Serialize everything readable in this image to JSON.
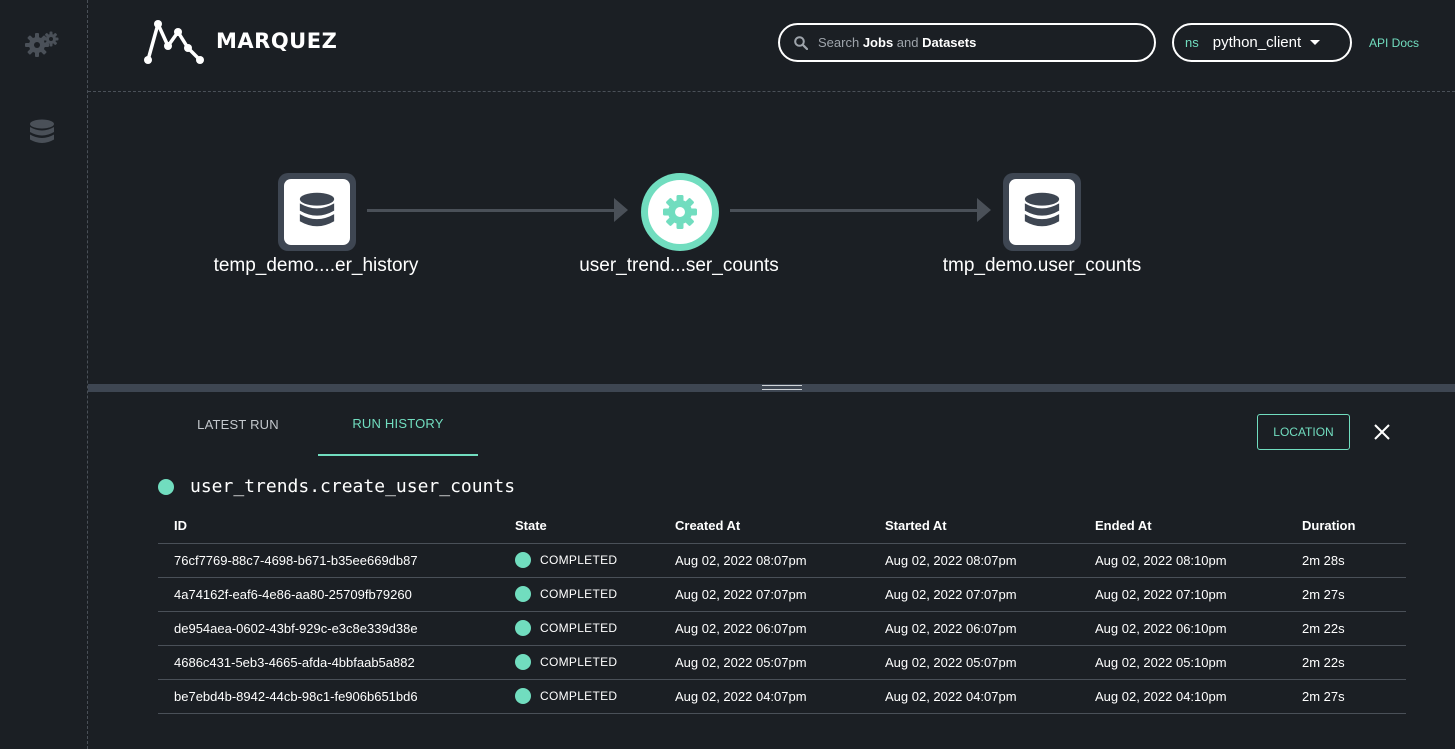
{
  "header": {
    "logo_text": "MARQUEZ",
    "search": {
      "prefix": "Search",
      "jobs": "Jobs",
      "and": "and",
      "datasets": "Datasets"
    },
    "namespace": {
      "label": "ns",
      "value": "python_client"
    },
    "api_docs": "API Docs"
  },
  "sidebar": {
    "items": [
      {
        "icon": "gears-icon"
      },
      {
        "icon": "database-icon"
      }
    ]
  },
  "graph": {
    "nodes": [
      {
        "type": "dataset",
        "label": "temp_demo....er_history"
      },
      {
        "type": "job",
        "label": "user_trend...ser_counts"
      },
      {
        "type": "dataset",
        "label": "tmp_demo.user_counts"
      }
    ]
  },
  "panel": {
    "tabs": [
      {
        "label": "LATEST RUN",
        "active": false
      },
      {
        "label": "RUN HISTORY",
        "active": true
      }
    ],
    "location_button": "LOCATION",
    "job_name": "user_trends.create_user_counts",
    "table": {
      "headers": [
        "ID",
        "State",
        "Created At",
        "Started At",
        "Ended At",
        "Duration"
      ],
      "rows": [
        {
          "id": "76cf7769-88c7-4698-b671-b35ee669db87",
          "state": "COMPLETED",
          "created": "Aug 02, 2022 08:07pm",
          "started": "Aug 02, 2022 08:07pm",
          "ended": "Aug 02, 2022 08:10pm",
          "duration": "2m 28s"
        },
        {
          "id": "4a74162f-eaf6-4e86-aa80-25709fb79260",
          "state": "COMPLETED",
          "created": "Aug 02, 2022 07:07pm",
          "started": "Aug 02, 2022 07:07pm",
          "ended": "Aug 02, 2022 07:10pm",
          "duration": "2m 27s"
        },
        {
          "id": "de954aea-0602-43bf-929c-e3c8e339d38e",
          "state": "COMPLETED",
          "created": "Aug 02, 2022 06:07pm",
          "started": "Aug 02, 2022 06:07pm",
          "ended": "Aug 02, 2022 06:10pm",
          "duration": "2m 22s"
        },
        {
          "id": "4686c431-5eb3-4665-afda-4bbfaab5a882",
          "state": "COMPLETED",
          "created": "Aug 02, 2022 05:07pm",
          "started": "Aug 02, 2022 05:07pm",
          "ended": "Aug 02, 2022 05:10pm",
          "duration": "2m 22s"
        },
        {
          "id": "be7ebd4b-8942-44cb-98c1-fe906b651bd6",
          "state": "COMPLETED",
          "created": "Aug 02, 2022 04:07pm",
          "started": "Aug 02, 2022 04:07pm",
          "ended": "Aug 02, 2022 04:10pm",
          "duration": "2m 27s"
        }
      ]
    }
  },
  "colors": {
    "accent": "#71ddbf",
    "background": "#1b1f24",
    "node_bg": "#3e4652"
  }
}
